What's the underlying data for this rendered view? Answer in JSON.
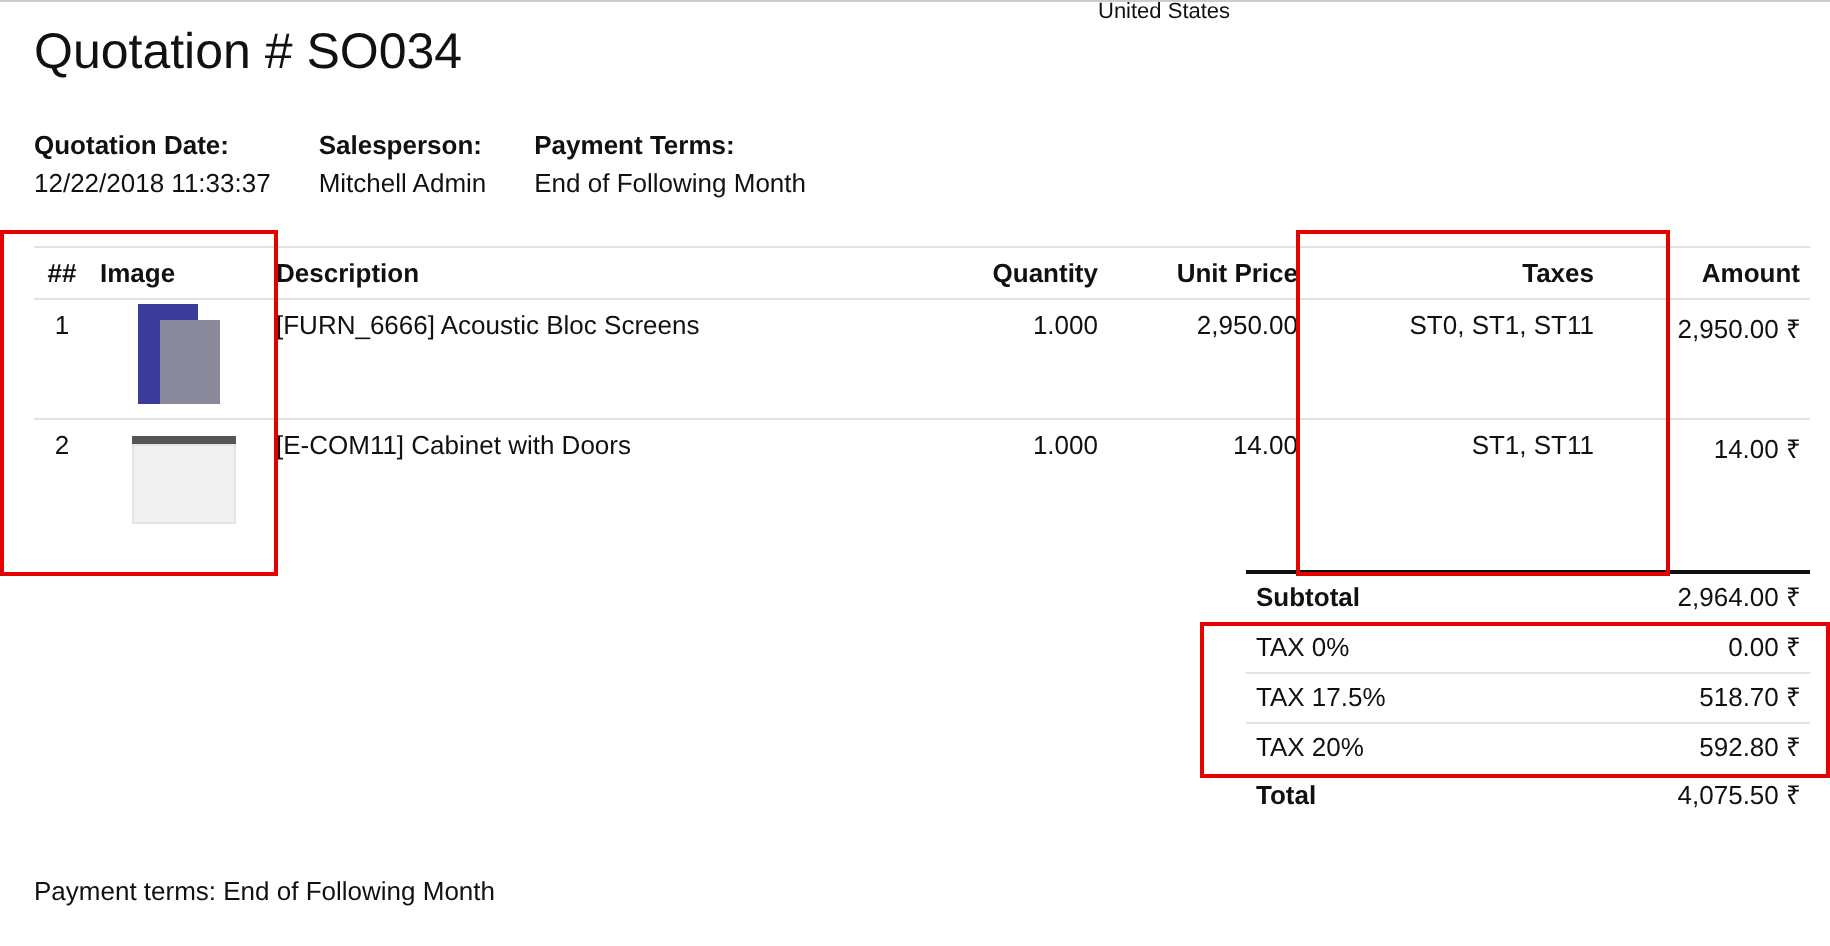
{
  "address_tail": "United States",
  "title": "Quotation # SO034",
  "info": [
    {
      "label": "Quotation Date:",
      "value": "12/22/2018 11:33:37"
    },
    {
      "label": "Salesperson:",
      "value": "Mitchell Admin"
    },
    {
      "label": "Payment Terms:",
      "value": "End of Following Month"
    }
  ],
  "table": {
    "columns": [
      {
        "label": "##",
        "highlighted": false
      },
      {
        "label": "Image",
        "highlighted": true
      },
      {
        "label": "Description",
        "highlighted": false
      },
      {
        "label": "Quantity",
        "highlighted": false
      },
      {
        "label": "Unit Price",
        "highlighted": false
      },
      {
        "label": "Taxes",
        "highlighted": true
      },
      {
        "label": "Amount",
        "highlighted": false
      }
    ],
    "rows": [
      {
        "number": "1",
        "kind": "screens",
        "description": "[FURN_6666] Acoustic Bloc Screens",
        "quantity": "1.000",
        "unit_price": "2,950.00",
        "taxes": "ST0, ST1, ST11",
        "amount": "2,950.00 ₹"
      },
      {
        "number": "2",
        "kind": "cabinet",
        "description": "[E-COM11] Cabinet with Doors",
        "quantity": "1.000",
        "unit_price": "14.00",
        "taxes": "ST1, ST11",
        "amount": "14.00 ₹"
      }
    ]
  },
  "totals": [
    {
      "kind": "subtotal",
      "label": "Subtotal",
      "value": "2,964.00 ₹",
      "highlighted": false
    },
    {
      "kind": "tax",
      "label": "TAX 0%",
      "value": "0.00 ₹",
      "highlighted": true
    },
    {
      "kind": "tax",
      "label": "TAX 17.5%",
      "value": "518.70 ₹",
      "highlighted": true
    },
    {
      "kind": "tax",
      "label": "TAX 20%",
      "value": "592.80 ₹",
      "highlighted": true
    },
    {
      "kind": "total",
      "label": "Total",
      "value": "4,075.50 ₹",
      "highlighted": false
    }
  ],
  "note": "Payment terms: End of Following Month"
}
